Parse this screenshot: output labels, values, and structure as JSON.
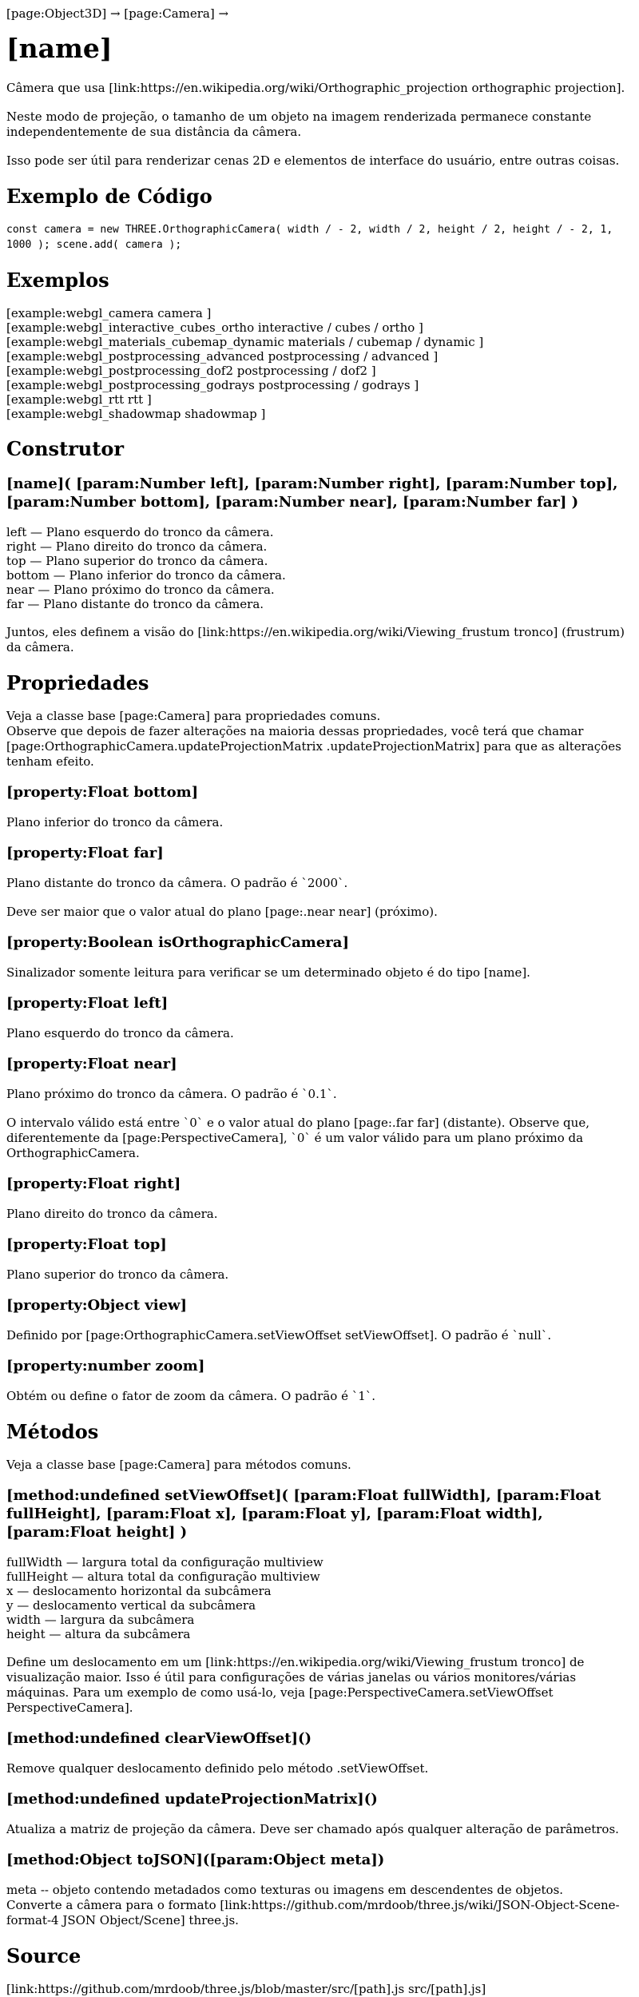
{
  "breadcrumb": {
    "text": "[page:Object3D] → [page:Camera] →"
  },
  "page_title": "[name]",
  "intro": [
    "Câmera que usa [link:https://en.wikipedia.org/wiki/Orthographic_projection orthographic projection].",
    "Neste modo de projeção, o tamanho de um objeto na imagem renderizada permanece constante independentemente de sua distância da câmera.",
    "Isso pode ser útil para renderizar cenas 2D e elementos de interface do usuário, entre outras coisas."
  ],
  "code_example": {
    "heading": "Exemplo de Código",
    "code": "const camera = new THREE.OrthographicCamera( width / - 2, width / 2, height / 2, height / - 2, 1, 1000 ); scene.add( camera );"
  },
  "examples": {
    "heading": "Exemplos",
    "items": [
      "[example:webgl_camera camera ]",
      "[example:webgl_interactive_cubes_ortho interactive / cubes / ortho ]",
      "[example:webgl_materials_cubemap_dynamic materials / cubemap / dynamic ]",
      "[example:webgl_postprocessing_advanced postprocessing / advanced ]",
      "[example:webgl_postprocessing_dof2 postprocessing / dof2 ]",
      "[example:webgl_postprocessing_godrays postprocessing / godrays ]",
      "[example:webgl_rtt rtt ]",
      "[example:webgl_shadowmap shadowmap ]"
    ]
  },
  "constructor": {
    "heading": "Construtor",
    "signature": "[name]( [param:Number left], [param:Number right], [param:Number top], [param:Number bottom], [param:Number near], [param:Number far] )",
    "params": [
      "left — Plano esquerdo do tronco da câmera.",
      "right — Plano direito do tronco da câmera.",
      "top — Plano superior do tronco da câmera.",
      "bottom — Plano inferior do tronco da câmera.",
      "near — Plano próximo do tronco da câmera.",
      "far — Plano distante do tronco da câmera."
    ],
    "note": "Juntos, eles definem a visão do [link:https://en.wikipedia.org/wiki/Viewing_frustum tronco] (frustrum) da câmera."
  },
  "properties": {
    "heading": "Propriedades",
    "intro_1": "Veja a classe base [page:Camera] para propriedades comuns.",
    "intro_2": "Observe que depois de fazer alterações na maioria dessas propriedades, você terá que chamar [page:OrthographicCamera.updateProjectionMatrix .updateProjectionMatrix] para que as alterações tenham efeito.",
    "items": [
      {
        "title": "[property:Float bottom]",
        "paras": [
          "Plano inferior do tronco da câmera."
        ]
      },
      {
        "title": "[property:Float far]",
        "paras": [
          "Plano distante do tronco da câmera. O padrão é `2000`.",
          "Deve ser maior que o valor atual do plano [page:.near near] (próximo)."
        ]
      },
      {
        "title": "[property:Boolean isOrthographicCamera]",
        "paras": [
          "Sinalizador somente leitura para verificar se um determinado objeto é do tipo [name]."
        ]
      },
      {
        "title": "[property:Float left]",
        "paras": [
          "Plano esquerdo do tronco da câmera."
        ]
      },
      {
        "title": "[property:Float near]",
        "paras": [
          "Plano próximo do tronco da câmera. O padrão é `0.1`.",
          "O intervalo válido está entre `0` e o valor atual do plano [page:.far far] (distante). Observe que, diferentemente da [page:PerspectiveCamera], `0` é um valor válido para um plano próximo da OrthographicCamera."
        ]
      },
      {
        "title": "[property:Float right]",
        "paras": [
          "Plano direito do tronco da câmera."
        ]
      },
      {
        "title": "[property:Float top]",
        "paras": [
          "Plano superior do tronco da câmera."
        ]
      },
      {
        "title": "[property:Object view]",
        "paras": [
          "Definido por [page:OrthographicCamera.setViewOffset setViewOffset]. O padrão é `null`."
        ]
      },
      {
        "title": "[property:number zoom]",
        "paras": [
          "Obtém ou define o fator de zoom da câmera. O padrão é `1`."
        ]
      }
    ]
  },
  "methods": {
    "heading": "Métodos",
    "intro": "Veja a classe base [page:Camera] para métodos comuns.",
    "set_view_offset": {
      "title": "[method:undefined setViewOffset]( [param:Float fullWidth], [param:Float fullHeight], [param:Float x], [param:Float y], [param:Float width], [param:Float height] )",
      "params": [
        "fullWidth — largura total da configuração multiview",
        "fullHeight — altura total da configuração multiview",
        "x — deslocamento horizontal da subcâmera",
        "y — deslocamento vertical da subcâmera",
        "width — largura da subcâmera",
        "height — altura da subcâmera"
      ],
      "desc": "Define um deslocamento em um [link:https://en.wikipedia.org/wiki/Viewing_frustum tronco] de visualização maior. Isso é útil para configurações de várias janelas ou vários monitores/várias máquinas. Para um exemplo de como usá-lo, veja [page:PerspectiveCamera.setViewOffset PerspectiveCamera]."
    },
    "clear_view_offset": {
      "title": "[method:undefined clearViewOffset]()",
      "desc": "Remove qualquer deslocamento definido pelo método .setViewOffset."
    },
    "update_projection_matrix": {
      "title": "[method:undefined updateProjectionMatrix]()",
      "desc": "Atualiza a matriz de projeção da câmera. Deve ser chamado após qualquer alteração de parâmetros."
    },
    "to_json": {
      "title": "[method:Object toJSON]([param:Object meta])",
      "line_1": "meta -- objeto contendo metadados como texturas ou imagens em descendentes de objetos.",
      "line_2": "Converte a câmera para o formato [link:https://github.com/mrdoob/three.js/wiki/JSON-Object-Scene-format-4 JSON Object/Scene] three.js."
    }
  },
  "source": {
    "heading": "Source",
    "link": "[link:https://github.com/mrdoob/three.js/blob/master/src/[path].js src/[path].js]"
  }
}
